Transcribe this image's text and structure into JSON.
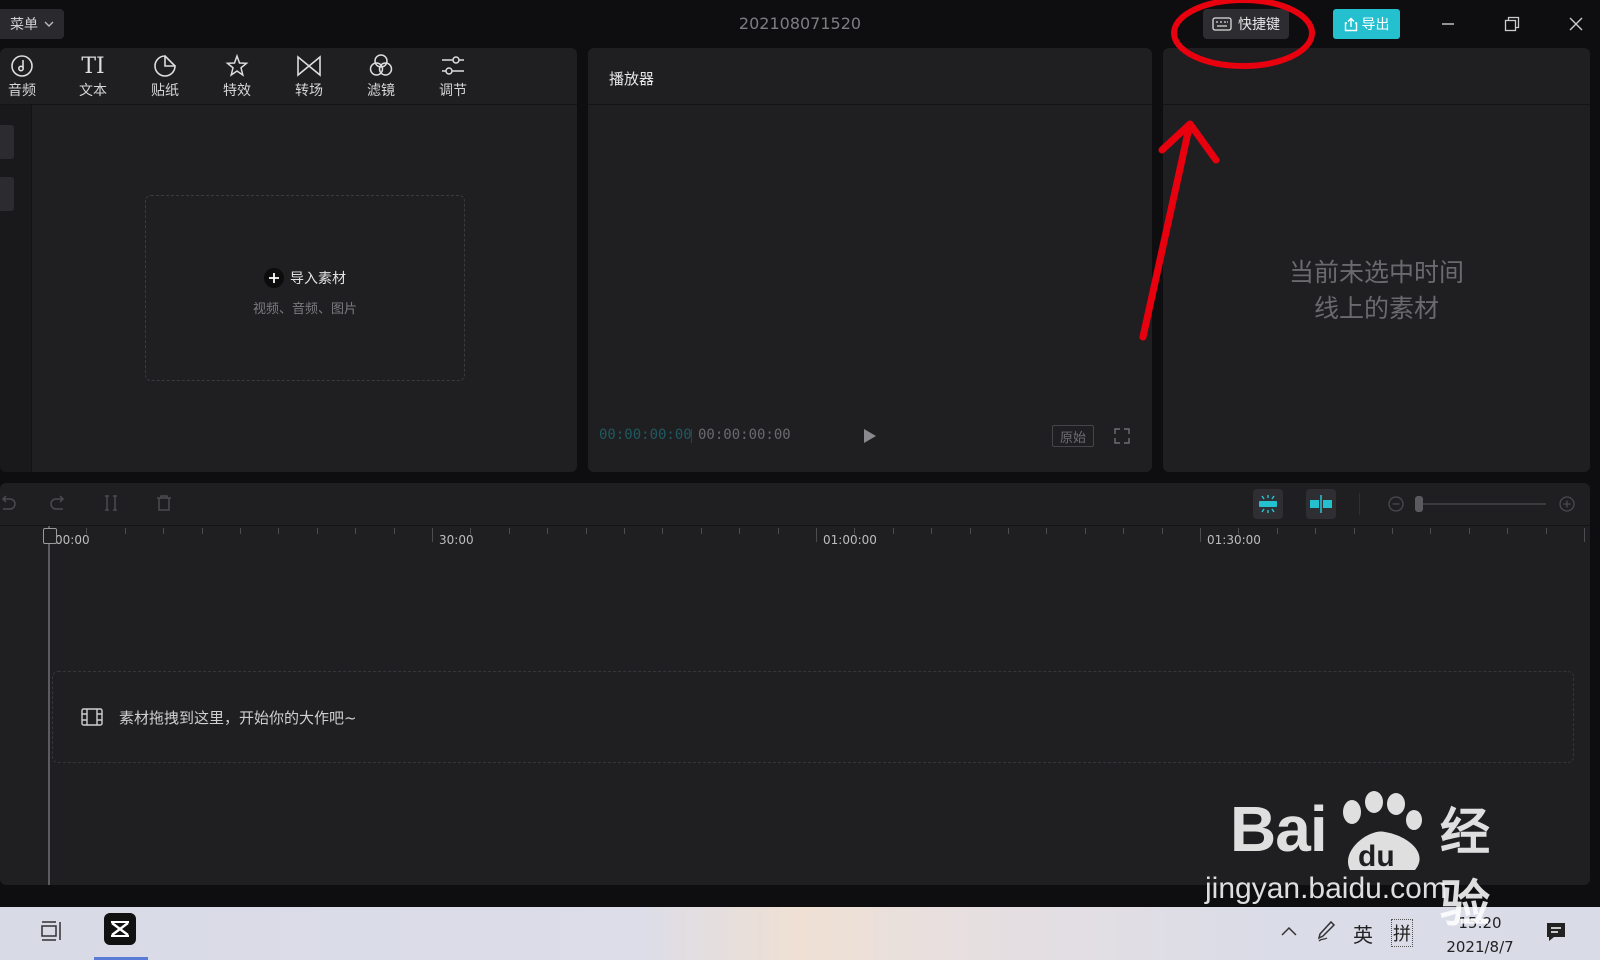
{
  "titlebar": {
    "menu_label": "菜单",
    "project_title": "202108071520",
    "shortcut_label": "快捷键",
    "export_label": "导出"
  },
  "toolbar": {
    "tools": [
      {
        "label": "音频",
        "icon": "audio-icon"
      },
      {
        "label": "文本",
        "icon": "text-icon"
      },
      {
        "label": "贴纸",
        "icon": "sticker-icon"
      },
      {
        "label": "特效",
        "icon": "effects-icon"
      },
      {
        "label": "转场",
        "icon": "transition-icon"
      },
      {
        "label": "滤镜",
        "icon": "filter-icon"
      },
      {
        "label": "调节",
        "icon": "adjust-icon"
      }
    ],
    "text_icon_glyph": "TI"
  },
  "media": {
    "import_label": "导入素材",
    "import_sub": "视频、音频、图片"
  },
  "player": {
    "title": "播放器",
    "current_time": "00:00:00:00",
    "total_time": "00:00:00:00",
    "ratio_label": "原始"
  },
  "attributes": {
    "empty_line1": "当前未选中时间",
    "empty_line2": "线上的素材"
  },
  "timeline": {
    "ruler_labels": [
      "00:00",
      "30:00",
      "01:00:00",
      "01:30:00"
    ],
    "drop_hint": "素材拖拽到这里，开始你的大作吧~"
  },
  "taskbar": {
    "ime_lang": "英",
    "ime_mode": "拼",
    "time": "15:20",
    "date": "2021/8/7"
  },
  "watermark": {
    "brand": "Bai",
    "brand_du": "du",
    "brand_cn": "经验",
    "url": "jingyan.baidu.com"
  },
  "colors": {
    "accent": "#25c0cf",
    "background": "#0e0e10",
    "panel": "#1f1f22",
    "annotation": "#e8000f"
  }
}
